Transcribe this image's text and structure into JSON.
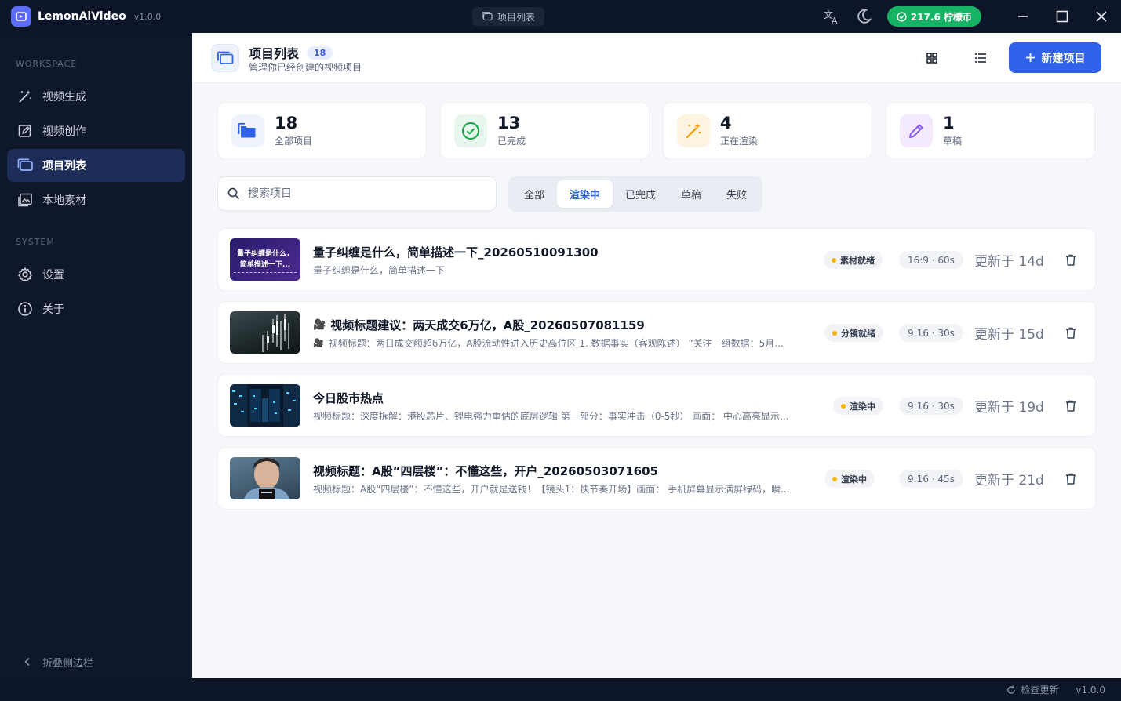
{
  "app": {
    "name": "LemonAiVideo",
    "version": "v1.0.0",
    "window_title": "项目列表",
    "coins": "217.6 柠檬币"
  },
  "colors": {
    "accent": "#2f62e8",
    "coin_badge": "#16b364",
    "sidebar_bg": "#0f172a",
    "status_dot": "#f5b400"
  },
  "sidebar": {
    "workspace_label": "WORKSPACE",
    "system_label": "SYSTEM",
    "workspace_items": [
      {
        "label": "视频生成",
        "icon": "magic-wand-icon"
      },
      {
        "label": "视频创作",
        "icon": "edit-square-icon"
      },
      {
        "label": "项目列表",
        "icon": "folder-stack-icon",
        "active": true
      },
      {
        "label": "本地素材",
        "icon": "image-gallery-icon"
      }
    ],
    "system_items": [
      {
        "label": "设置",
        "icon": "gear-icon"
      },
      {
        "label": "关于",
        "icon": "info-icon"
      }
    ],
    "collapse_label": "折叠侧边栏"
  },
  "header": {
    "title": "项目列表",
    "count": "18",
    "subtitle": "管理你已经创建的视频项目",
    "new_button": "新建项目"
  },
  "stats": [
    {
      "value": "18",
      "label": "全部项目",
      "icon": "folder-icon"
    },
    {
      "value": "13",
      "label": "已完成",
      "icon": "check-circle-icon"
    },
    {
      "value": "4",
      "label": "正在渲染",
      "icon": "magic-wand-icon"
    },
    {
      "value": "1",
      "label": "草稿",
      "icon": "pencil-icon"
    }
  ],
  "search": {
    "placeholder": "搜索项目"
  },
  "filters": [
    {
      "label": "全部"
    },
    {
      "label": "渲染中",
      "active": true
    },
    {
      "label": "已完成"
    },
    {
      "label": "草稿"
    },
    {
      "label": "失败"
    }
  ],
  "projects": [
    {
      "title": "量子纠缠是什么，简单描述一下_20260510091300",
      "desc": "量子纠缠是什么，简单描述一下",
      "thumb_text": "量子纠缠是什么，简单描述一下...",
      "status": "素材就绪",
      "ratio": "16:9 · 60s",
      "updated": "更新于 14d"
    },
    {
      "title": "视频标题建议：两天成交6万亿，A股_20260507081159",
      "desc": "视频标题：两日成交额超6万亿，A股流动性进入历史高位区 1. 数据事实（客观陈述） “关注一组数据：5月...",
      "status": "分镜就绪",
      "ratio": "9:16 · 30s",
      "updated": "更新于 15d",
      "emoji": "🎥"
    },
    {
      "title": "今日股市热点",
      "desc": "视频标题：深度拆解：港股芯片、锂电强力重估的底层逻辑 第一部分：事实冲击（0-5秒） 画面： 中心高亮显示...",
      "status": "渲染中",
      "ratio": "9:16 · 30s",
      "updated": "更新于 19d"
    },
    {
      "title": "视频标题：A股“四层楼”：不懂这些，开户_20260503071605",
      "desc": "视频标题：A股“四层楼”：不懂这些，开户就是送钱！【镜头1：快节奏开场】画面： 手机屏幕显示满屏绿码，瞬...",
      "status": "渲染中",
      "ratio": "9:16 · 45s",
      "updated": "更新于 21d"
    }
  ],
  "statusbar": {
    "check_update": "检查更新",
    "version": "v1.0.0"
  }
}
